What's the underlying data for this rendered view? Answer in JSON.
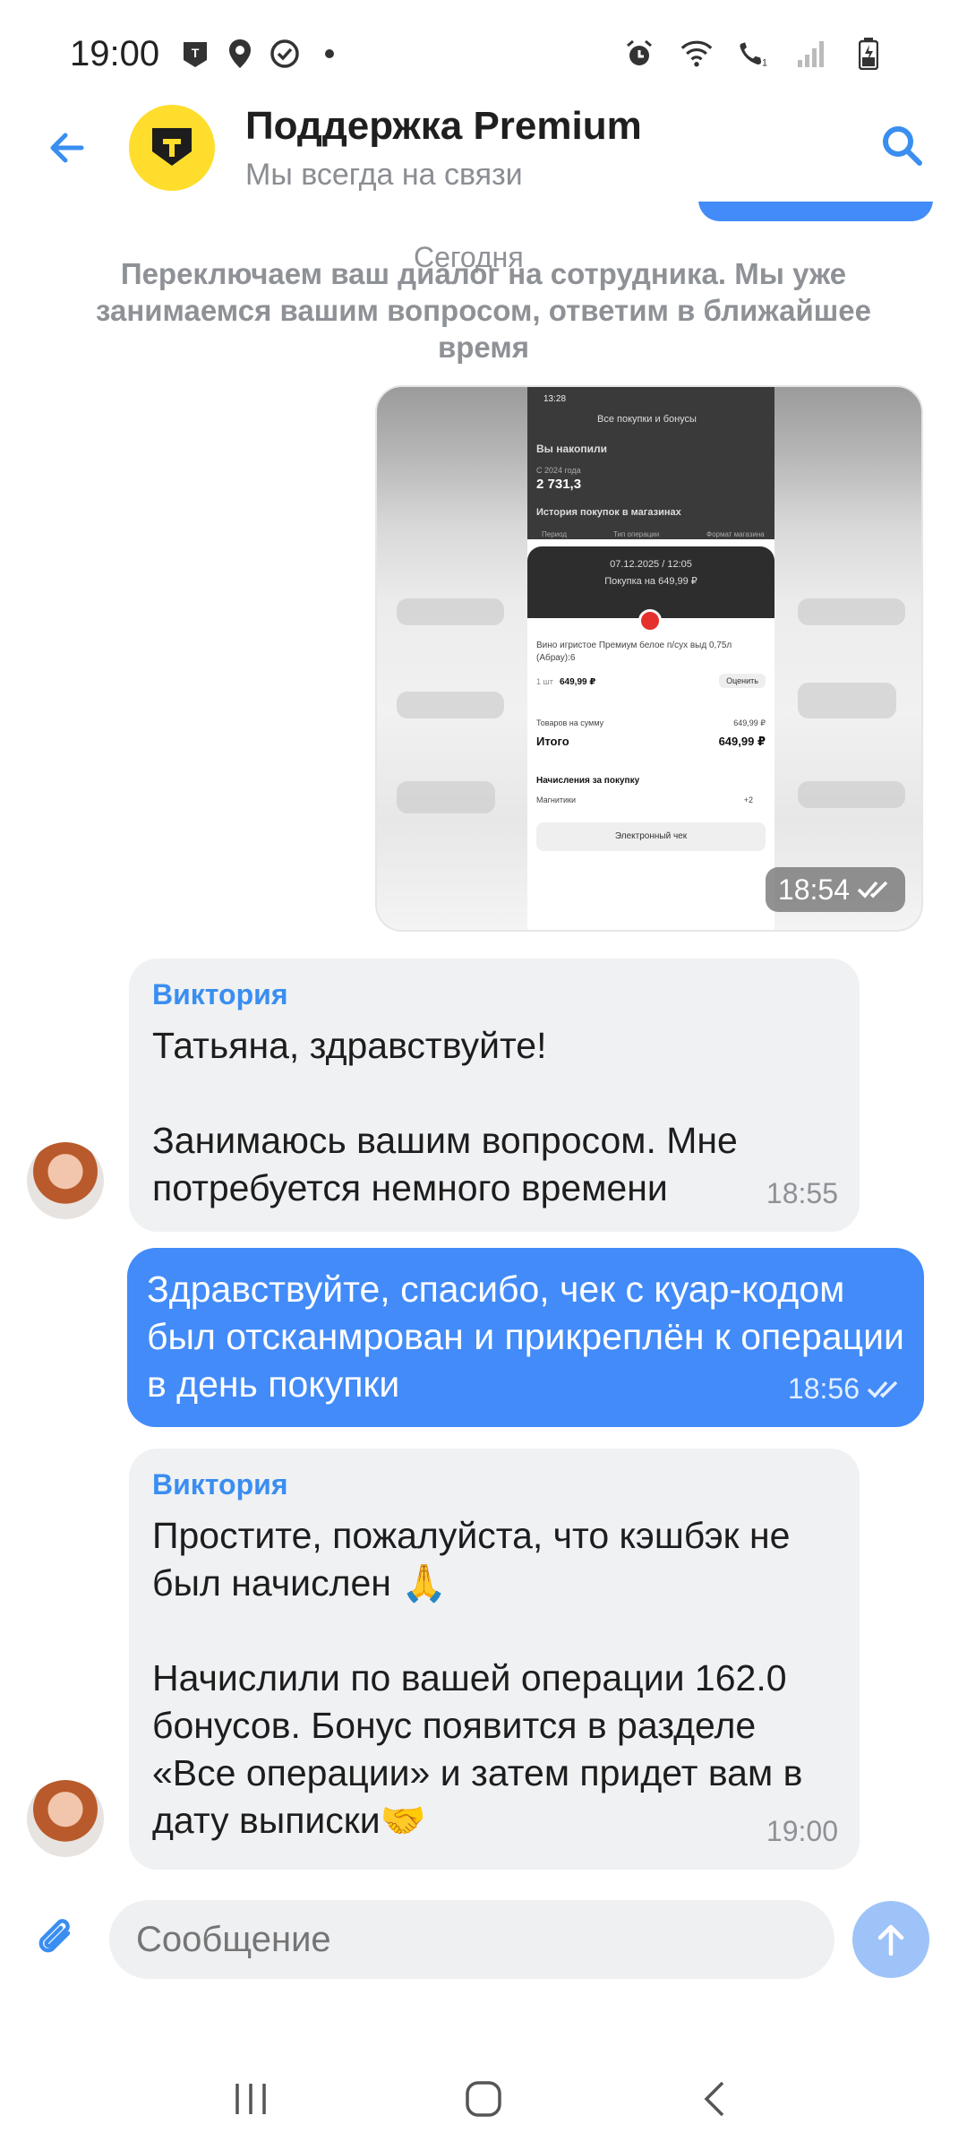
{
  "status_bar": {
    "time": "19:00",
    "icons": [
      "app-notification-icon",
      "location-icon",
      "check-circle-icon",
      "dot-icon",
      "alarm-icon",
      "wifi-icon",
      "wifi-call-icon",
      "signal-icon",
      "battery-charging-icon"
    ]
  },
  "header": {
    "title": "Поддержка Premium",
    "subtitle": "Мы всегда на связи",
    "brand_color": "#ffdd2d"
  },
  "chat": {
    "date_divider": "Сегодня",
    "system_message": "Переключаем ваш диалог на сотрудника. Мы уже занимаемся вашим вопросом, ответим в ближайшее время",
    "image_message": {
      "time": "18:54",
      "screenshot": {
        "status_time": "13:28",
        "title": "Все покупки и бонусы",
        "accumulated_label": "Вы накопили",
        "since": "С 2024 года",
        "amount": "2 731,3",
        "history_label": "История покупок в магазинах",
        "filters": [
          "Период",
          "Тип операции",
          "Формат магазина"
        ],
        "receipt_date": "07.12.2025 / 12:05",
        "receipt_sum": "Покупка на 649,99 ₽",
        "item_name": "Вино игристое Премиум белое п/сух выд 0,75л (Абрау):6",
        "item_qty": "1 шт",
        "item_price": "649,99 ₽",
        "rate_label": "Оценить",
        "goods_label": "Товаров на сумму",
        "goods_value": "649,99 ₽",
        "total_label": "Итого",
        "total_value": "649,99 ₽",
        "accrual_label": "Начисления за покупку",
        "magnit_label": "Магнитики",
        "magnit_value": "+2",
        "e_check_label": "Электронный чек"
      }
    },
    "messages": [
      {
        "direction": "in",
        "sender": "Виктория",
        "text": "Татьяна, здравствуйте!\n\nЗанимаюсь вашим вопросом. Мне потребуется немного времени",
        "time": "18:55"
      },
      {
        "direction": "out",
        "text": "Здравствуйте, спасибо, чек с куар-кодом был отсканмрован и прикреплён к операции в день покупки",
        "time": "18:56"
      },
      {
        "direction": "in",
        "sender": "Виктория",
        "text": "Простите, пожалуйста, что кэшбэк не был начислен 🙏\n\nНачислили по вашей операции 162.0 бонусов. Бонус появится в разделе «Все операции» и затем придет вам в дату выписки🤝",
        "time": "19:00"
      }
    ]
  },
  "composer": {
    "placeholder": "Сообщение"
  },
  "colors": {
    "accent": "#428bf9",
    "incoming_bubble": "#f0f1f3",
    "sender_name": "#3a8ef0"
  }
}
